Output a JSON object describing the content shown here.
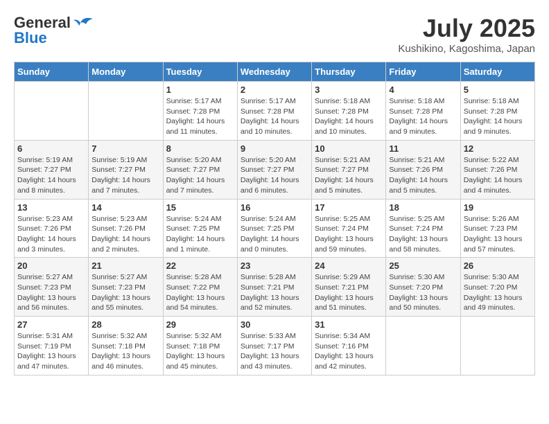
{
  "logo": {
    "general": "General",
    "blue": "Blue"
  },
  "title": "July 2025",
  "location": "Kushikino, Kagoshima, Japan",
  "days_of_week": [
    "Sunday",
    "Monday",
    "Tuesday",
    "Wednesday",
    "Thursday",
    "Friday",
    "Saturday"
  ],
  "weeks": [
    [
      {
        "day": "",
        "info": ""
      },
      {
        "day": "",
        "info": ""
      },
      {
        "day": "1",
        "info": "Sunrise: 5:17 AM\nSunset: 7:28 PM\nDaylight: 14 hours and 11 minutes."
      },
      {
        "day": "2",
        "info": "Sunrise: 5:17 AM\nSunset: 7:28 PM\nDaylight: 14 hours and 10 minutes."
      },
      {
        "day": "3",
        "info": "Sunrise: 5:18 AM\nSunset: 7:28 PM\nDaylight: 14 hours and 10 minutes."
      },
      {
        "day": "4",
        "info": "Sunrise: 5:18 AM\nSunset: 7:28 PM\nDaylight: 14 hours and 9 minutes."
      },
      {
        "day": "5",
        "info": "Sunrise: 5:18 AM\nSunset: 7:28 PM\nDaylight: 14 hours and 9 minutes."
      }
    ],
    [
      {
        "day": "6",
        "info": "Sunrise: 5:19 AM\nSunset: 7:27 PM\nDaylight: 14 hours and 8 minutes."
      },
      {
        "day": "7",
        "info": "Sunrise: 5:19 AM\nSunset: 7:27 PM\nDaylight: 14 hours and 7 minutes."
      },
      {
        "day": "8",
        "info": "Sunrise: 5:20 AM\nSunset: 7:27 PM\nDaylight: 14 hours and 7 minutes."
      },
      {
        "day": "9",
        "info": "Sunrise: 5:20 AM\nSunset: 7:27 PM\nDaylight: 14 hours and 6 minutes."
      },
      {
        "day": "10",
        "info": "Sunrise: 5:21 AM\nSunset: 7:27 PM\nDaylight: 14 hours and 5 minutes."
      },
      {
        "day": "11",
        "info": "Sunrise: 5:21 AM\nSunset: 7:26 PM\nDaylight: 14 hours and 5 minutes."
      },
      {
        "day": "12",
        "info": "Sunrise: 5:22 AM\nSunset: 7:26 PM\nDaylight: 14 hours and 4 minutes."
      }
    ],
    [
      {
        "day": "13",
        "info": "Sunrise: 5:23 AM\nSunset: 7:26 PM\nDaylight: 14 hours and 3 minutes."
      },
      {
        "day": "14",
        "info": "Sunrise: 5:23 AM\nSunset: 7:26 PM\nDaylight: 14 hours and 2 minutes."
      },
      {
        "day": "15",
        "info": "Sunrise: 5:24 AM\nSunset: 7:25 PM\nDaylight: 14 hours and 1 minute."
      },
      {
        "day": "16",
        "info": "Sunrise: 5:24 AM\nSunset: 7:25 PM\nDaylight: 14 hours and 0 minutes."
      },
      {
        "day": "17",
        "info": "Sunrise: 5:25 AM\nSunset: 7:24 PM\nDaylight: 13 hours and 59 minutes."
      },
      {
        "day": "18",
        "info": "Sunrise: 5:25 AM\nSunset: 7:24 PM\nDaylight: 13 hours and 58 minutes."
      },
      {
        "day": "19",
        "info": "Sunrise: 5:26 AM\nSunset: 7:23 PM\nDaylight: 13 hours and 57 minutes."
      }
    ],
    [
      {
        "day": "20",
        "info": "Sunrise: 5:27 AM\nSunset: 7:23 PM\nDaylight: 13 hours and 56 minutes."
      },
      {
        "day": "21",
        "info": "Sunrise: 5:27 AM\nSunset: 7:23 PM\nDaylight: 13 hours and 55 minutes."
      },
      {
        "day": "22",
        "info": "Sunrise: 5:28 AM\nSunset: 7:22 PM\nDaylight: 13 hours and 54 minutes."
      },
      {
        "day": "23",
        "info": "Sunrise: 5:28 AM\nSunset: 7:21 PM\nDaylight: 13 hours and 52 minutes."
      },
      {
        "day": "24",
        "info": "Sunrise: 5:29 AM\nSunset: 7:21 PM\nDaylight: 13 hours and 51 minutes."
      },
      {
        "day": "25",
        "info": "Sunrise: 5:30 AM\nSunset: 7:20 PM\nDaylight: 13 hours and 50 minutes."
      },
      {
        "day": "26",
        "info": "Sunrise: 5:30 AM\nSunset: 7:20 PM\nDaylight: 13 hours and 49 minutes."
      }
    ],
    [
      {
        "day": "27",
        "info": "Sunrise: 5:31 AM\nSunset: 7:19 PM\nDaylight: 13 hours and 47 minutes."
      },
      {
        "day": "28",
        "info": "Sunrise: 5:32 AM\nSunset: 7:18 PM\nDaylight: 13 hours and 46 minutes."
      },
      {
        "day": "29",
        "info": "Sunrise: 5:32 AM\nSunset: 7:18 PM\nDaylight: 13 hours and 45 minutes."
      },
      {
        "day": "30",
        "info": "Sunrise: 5:33 AM\nSunset: 7:17 PM\nDaylight: 13 hours and 43 minutes."
      },
      {
        "day": "31",
        "info": "Sunrise: 5:34 AM\nSunset: 7:16 PM\nDaylight: 13 hours and 42 minutes."
      },
      {
        "day": "",
        "info": ""
      },
      {
        "day": "",
        "info": ""
      }
    ]
  ]
}
